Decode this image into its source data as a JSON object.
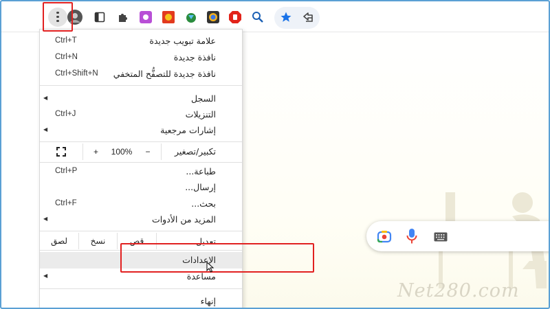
{
  "menu": {
    "new_tab": {
      "label": "علامة تبويب جديدة",
      "shortcut": "Ctrl+T"
    },
    "new_window": {
      "label": "نافذة جديدة",
      "shortcut": "Ctrl+N"
    },
    "incognito": {
      "label": "نافذة جديدة للتصفُّح المتخفي",
      "shortcut": "Ctrl+Shift+N"
    },
    "history": {
      "label": "السجل"
    },
    "downloads": {
      "label": "التنزيلات",
      "shortcut": "Ctrl+J"
    },
    "bookmarks": {
      "label": "إشارات مرجعية"
    },
    "zoom": {
      "label": "تكبير/تصغير",
      "minus": "−",
      "value": "100%",
      "plus": "+"
    },
    "print": {
      "label": "طباعة...",
      "shortcut": "Ctrl+P"
    },
    "cast": {
      "label": "إرسال..."
    },
    "find": {
      "label": "بحث...",
      "shortcut": "Ctrl+F"
    },
    "more_tools": {
      "label": "المزيد من الأدوات"
    },
    "edit": {
      "label": "تعديل",
      "cut": "قص",
      "copy": "نسخ",
      "paste": "لصق"
    },
    "settings": {
      "label": "الإعدادات"
    },
    "help": {
      "label": "مساعدة"
    },
    "exit": {
      "label": "إنهاء"
    }
  },
  "watermark": "Net280.com",
  "icons": {
    "menu": "kebab-menu-icon",
    "profile": "avatar",
    "side_panel": "side-panel-icon",
    "extensions": "puzzle-icon",
    "bookmark": "star-icon",
    "share": "share-icon",
    "camera": "google-lens-icon",
    "mic": "microphone-icon",
    "keyboard": "keyboard-icon"
  },
  "colors": {
    "highlight": "#e12020",
    "star": "#1a73e8",
    "hover": "#ebebeb"
  }
}
